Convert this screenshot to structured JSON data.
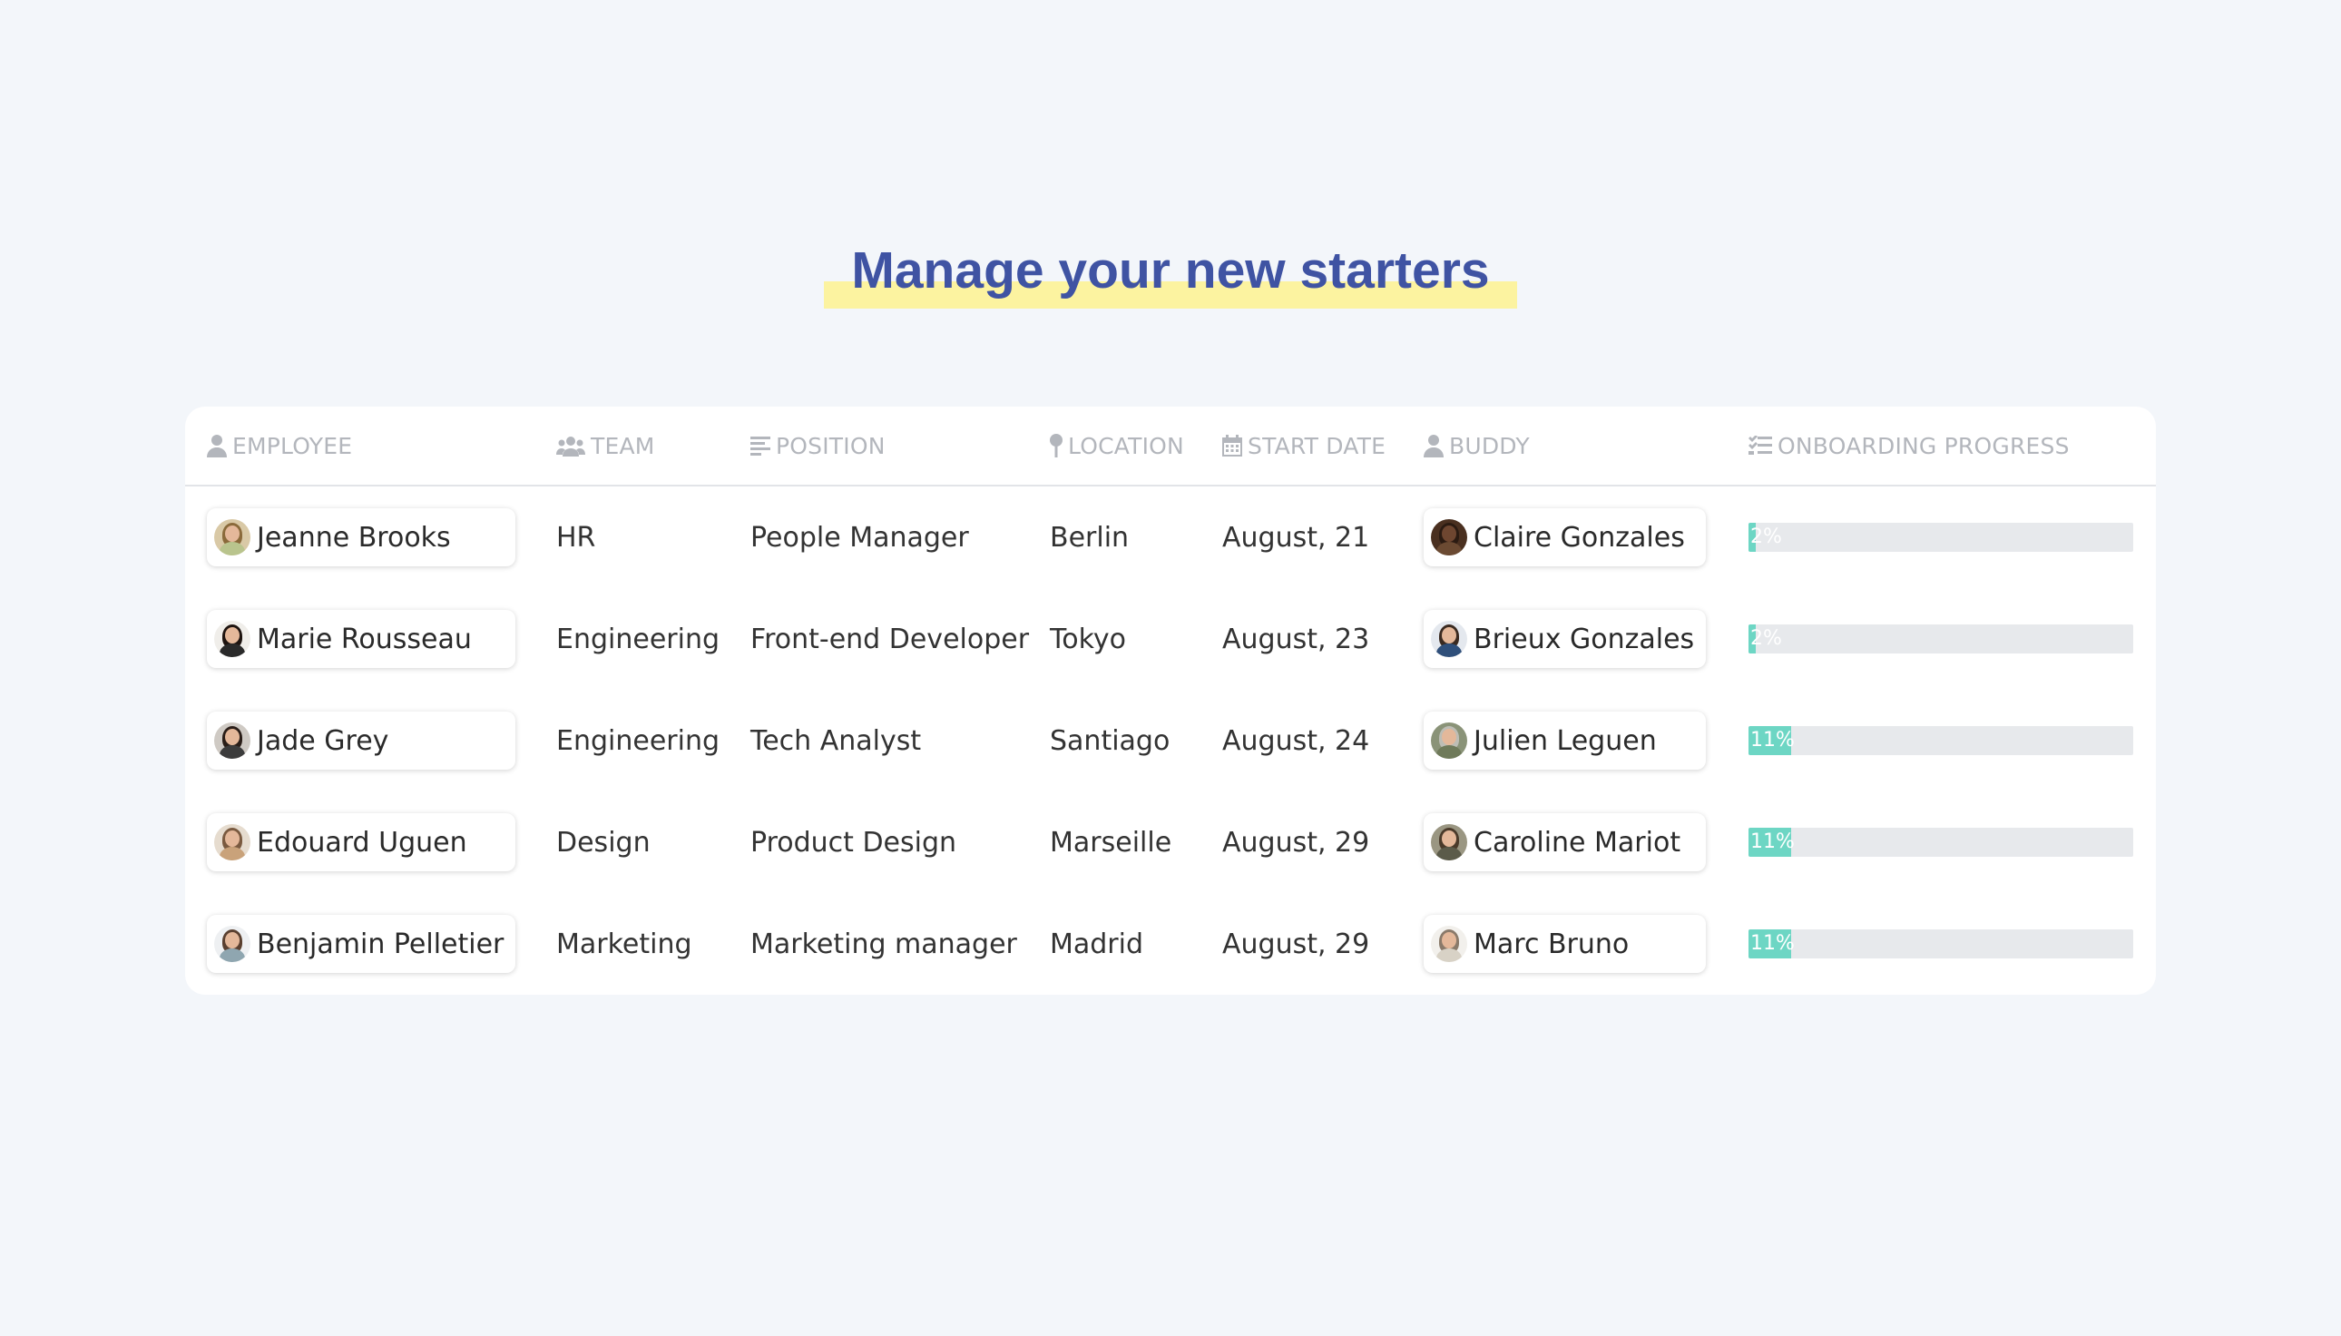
{
  "title": "Manage your new starters",
  "colors": {
    "title": "#3f53a3",
    "highlight": "#fcf3a0",
    "progress_fill": "#6dd6c4",
    "progress_track": "#e7e9ec"
  },
  "columns": {
    "employee": {
      "label": "EMPLOYEE",
      "icon": "person-icon"
    },
    "team": {
      "label": "TEAM",
      "icon": "people-icon"
    },
    "position": {
      "label": "POSITION",
      "icon": "text-lines-icon"
    },
    "location": {
      "label": "LOCATION",
      "icon": "location-pin-icon"
    },
    "start_date": {
      "label": "START DATE",
      "icon": "calendar-icon"
    },
    "buddy": {
      "label": "BUDDY",
      "icon": "person-icon"
    },
    "progress": {
      "label": "ONBOARDING PROGRESS",
      "icon": "checklist-icon"
    }
  },
  "rows": [
    {
      "employee": "Jeanne Brooks",
      "team": "HR",
      "position": "People Manager",
      "location": "Berlin",
      "start_date": "August, 21",
      "buddy": "Claire Gonzales",
      "progress_label": "2%",
      "progress": 0.02,
      "employee_avatar": {
        "hair": "#8a6a3a",
        "shirt": "#b9c48d",
        "bg": "#d9c9a6"
      },
      "buddy_avatar": {
        "hair": "#2b1b12",
        "shirt": "#6b4a32",
        "bg": "#4a3020",
        "skin": "#6e4630"
      }
    },
    {
      "employee": "Marie Rousseau",
      "team": "Engineering",
      "position": "Front-end Developer",
      "location": "Tokyo",
      "start_date": "August, 23",
      "buddy": "Brieux Gonzales",
      "progress_label": "2%",
      "progress": 0.02,
      "employee_avatar": {
        "hair": "#1e1410",
        "shirt": "#2a2a2a",
        "bg": "#f0eeea"
      },
      "buddy_avatar": {
        "hair": "#3a2a20",
        "shirt": "#2f4f7a",
        "bg": "#e4e8ee"
      }
    },
    {
      "employee": "Jade Grey",
      "team": "Engineering",
      "position": "Tech Analyst",
      "location": "Santiago",
      "start_date": "August, 24",
      "buddy": "Julien Leguen",
      "progress_label": "11%",
      "progress": 0.11,
      "employee_avatar": {
        "hair": "#2a1e18",
        "shirt": "#3c3c3c",
        "bg": "#cfcac4"
      },
      "buddy_avatar": {
        "hair": "#bdbdb5",
        "shirt": "#6f7a5a",
        "bg": "#8a9378"
      }
    },
    {
      "employee": "Edouard Uguen",
      "team": "Design",
      "position": "Product Design",
      "location": "Marseille",
      "start_date": "August, 29",
      "buddy": "Caroline Mariot",
      "progress_label": "11%",
      "progress": 0.11,
      "employee_avatar": {
        "hair": "#7a5a40",
        "shirt": "#c9a27a",
        "bg": "#e6dccf"
      },
      "buddy_avatar": {
        "hair": "#4a3a2a",
        "shirt": "#5b5b4a",
        "bg": "#9a9682"
      }
    },
    {
      "employee": "Benjamin Pelletier",
      "team": "Marketing",
      "position": "Marketing manager",
      "location": "Madrid",
      "start_date": "August, 29",
      "buddy": "Marc Bruno",
      "progress_label": "11%",
      "progress": 0.11,
      "employee_avatar": {
        "hair": "#5a4030",
        "shirt": "#8fa6b0",
        "bg": "#eef0f2"
      },
      "buddy_avatar": {
        "hair": "#8a7a6a",
        "shirt": "#d8d2c6",
        "bg": "#f2f0ec"
      }
    }
  ]
}
